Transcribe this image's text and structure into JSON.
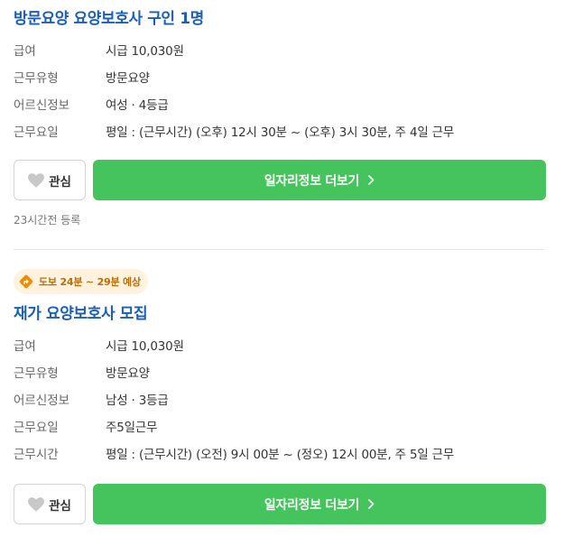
{
  "jobs": [
    {
      "title": "방문요양 요양보호사 구인 1명",
      "details": [
        {
          "label": "급여",
          "value": "시급 10,030원"
        },
        {
          "label": "근무유형",
          "value": "방문요양"
        },
        {
          "label": "어르신정보",
          "value": "여성 · 4등급"
        },
        {
          "label": "근무요일",
          "value": "평일 : (근무시간) (오후) 12시 30분 ~ (오후) 3시 30분, 주 4일 근무"
        }
      ],
      "like_label": "관심",
      "more_label": "일자리정보 더보기",
      "posted": "23시간전 등록"
    },
    {
      "travel_badge": "도보 24분 ~ 29분 예상",
      "title": "재가 요양보호사 모집",
      "details": [
        {
          "label": "급여",
          "value": "시급 10,030원"
        },
        {
          "label": "근무유형",
          "value": "방문요양"
        },
        {
          "label": "어르신정보",
          "value": "남성 · 3등급"
        },
        {
          "label": "근무요일",
          "value": "주5일근무"
        },
        {
          "label": "근무시간",
          "value": "평일 : (근무시간) (오전) 9시 00분 ~ (정오) 12시 00분, 주 5일 근무"
        }
      ],
      "like_label": "관심",
      "more_label": "일자리정보 더보기"
    }
  ],
  "icons": {
    "like": "heart-icon",
    "more": "chevron-right-icon",
    "travel": "directions-icon"
  },
  "colors": {
    "title": "#1a5fb4",
    "primary_button": "#45c35c",
    "heart": "#c8c8c8",
    "badge_bg": "#fff3df",
    "badge_text": "#b96d0a",
    "badge_icon": "#f08a00"
  }
}
